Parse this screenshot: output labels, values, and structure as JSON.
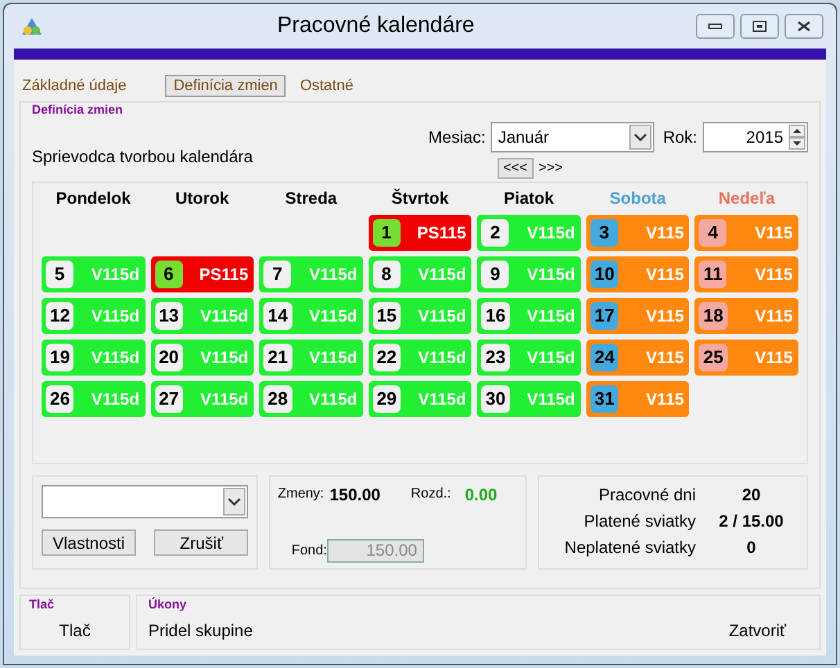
{
  "window": {
    "title": "Pracovné kalendáre"
  },
  "tabs": [
    {
      "label": "Základné údaje",
      "selected": false
    },
    {
      "label": "Definícia zmien",
      "selected": true
    },
    {
      "label": "Ostatné",
      "selected": false
    }
  ],
  "group_title": "Definícia zmien",
  "wizard_label": "Sprievodca tvorbou kalendára",
  "month": {
    "label": "Mesiac:",
    "value": "Január"
  },
  "year": {
    "label": "Rok:",
    "value": "2015"
  },
  "nav": {
    "prev": "<<<",
    "next": ">>>"
  },
  "weekdays": [
    {
      "label": "Pondelok",
      "color": "#000000"
    },
    {
      "label": "Utorok",
      "color": "#000000"
    },
    {
      "label": "Streda",
      "color": "#000000"
    },
    {
      "label": "Štvrtok",
      "color": "#000000"
    },
    {
      "label": "Piatok",
      "color": "#000000"
    },
    {
      "label": "Sobota",
      "color": "#4aa3d0"
    },
    {
      "label": "Nedeľa",
      "color": "#e8735a"
    }
  ],
  "weeks": [
    [
      {
        "kind": "empty"
      },
      {
        "kind": "empty"
      },
      {
        "kind": "empty"
      },
      {
        "day": "1",
        "code": "PS115",
        "kind": "holiday"
      },
      {
        "day": "2",
        "code": "V115d",
        "kind": "workday"
      },
      {
        "day": "3",
        "code": "V115",
        "kind": "saturday"
      },
      {
        "day": "4",
        "code": "V115",
        "kind": "sunday"
      }
    ],
    [
      {
        "day": "5",
        "code": "V115d",
        "kind": "workday"
      },
      {
        "day": "6",
        "code": "PS115",
        "kind": "holiday"
      },
      {
        "day": "7",
        "code": "V115d",
        "kind": "workday"
      },
      {
        "day": "8",
        "code": "V115d",
        "kind": "workday"
      },
      {
        "day": "9",
        "code": "V115d",
        "kind": "workday"
      },
      {
        "day": "10",
        "code": "V115",
        "kind": "saturday"
      },
      {
        "day": "11",
        "code": "V115",
        "kind": "sunday"
      }
    ],
    [
      {
        "day": "12",
        "code": "V115d",
        "kind": "workday"
      },
      {
        "day": "13",
        "code": "V115d",
        "kind": "workday"
      },
      {
        "day": "14",
        "code": "V115d",
        "kind": "workday"
      },
      {
        "day": "15",
        "code": "V115d",
        "kind": "workday"
      },
      {
        "day": "16",
        "code": "V115d",
        "kind": "workday"
      },
      {
        "day": "17",
        "code": "V115",
        "kind": "saturday"
      },
      {
        "day": "18",
        "code": "V115",
        "kind": "sunday"
      }
    ],
    [
      {
        "day": "19",
        "code": "V115d",
        "kind": "workday"
      },
      {
        "day": "20",
        "code": "V115d",
        "kind": "workday"
      },
      {
        "day": "21",
        "code": "V115d",
        "kind": "workday"
      },
      {
        "day": "22",
        "code": "V115d",
        "kind": "workday"
      },
      {
        "day": "23",
        "code": "V115d",
        "kind": "workday"
      },
      {
        "day": "24",
        "code": "V115",
        "kind": "saturday"
      },
      {
        "day": "25",
        "code": "V115",
        "kind": "sunday"
      }
    ],
    [
      {
        "day": "26",
        "code": "V115d",
        "kind": "workday"
      },
      {
        "day": "27",
        "code": "V115d",
        "kind": "workday"
      },
      {
        "day": "28",
        "code": "V115d",
        "kind": "workday"
      },
      {
        "day": "29",
        "code": "V115d",
        "kind": "workday"
      },
      {
        "day": "30",
        "code": "V115d",
        "kind": "workday"
      },
      {
        "day": "31",
        "code": "V115",
        "kind": "saturday"
      },
      {
        "kind": "empty"
      }
    ]
  ],
  "buttons": {
    "properties": "Vlastnosti",
    "cancel": "Zrušiť"
  },
  "totals": {
    "shifts_label": "Zmeny:",
    "shifts": "150.00",
    "diff_label": "Rozd.:",
    "diff": "0.00",
    "fund_label": "Fond:",
    "fund": "150.00"
  },
  "summary": [
    {
      "label": "Pracovné dni",
      "value": "20"
    },
    {
      "label": "Platené sviatky",
      "value": "2 / 15.00"
    },
    {
      "label": "Neplatené sviatky",
      "value": "0"
    }
  ],
  "print_group": {
    "title": "Tlač",
    "action": "Tlač"
  },
  "actions_group": {
    "title": "Úkony",
    "action": "Pridel skupine",
    "close": "Zatvoriť"
  }
}
